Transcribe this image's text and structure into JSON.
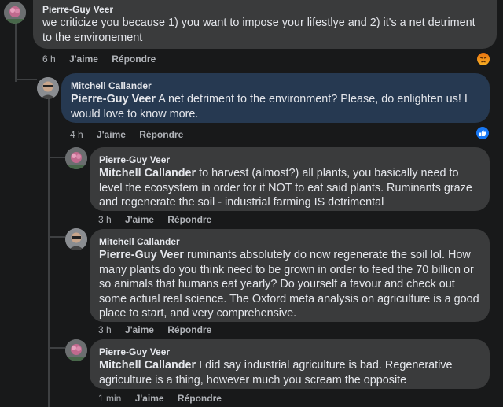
{
  "comments": [
    {
      "author": "Pierre-Guy Veer",
      "mention": "",
      "text": "we criticize you because 1) you want to impose your lifestlye and 2) it's a net detriment to the environement",
      "time": "6 h",
      "like_label": "J'aime",
      "reply_label": "Répondre",
      "reaction": "angry-reaction-icon"
    },
    {
      "author": "Mitchell Callander",
      "mention": "Pierre-Guy Veer",
      "text": "A net detriment to the environment? Please, do enlighten us! I would love to know more.",
      "time": "4 h",
      "like_label": "J'aime",
      "reply_label": "Répondre",
      "reaction": "like-reaction-icon"
    },
    {
      "author": "Pierre-Guy Veer",
      "mention": "Mitchell Callander",
      "text": "to harvest (almost?) all plants, you basically need to level the ecosystem in order for it NOT to eat said plants. Ruminants graze and regenerate the soil - industrial farming IS detrimental",
      "time": "3 h",
      "like_label": "J'aime",
      "reply_label": "Répondre"
    },
    {
      "author": "Mitchell Callander",
      "mention": "Pierre-Guy Veer",
      "text": "ruminants absolutely do now regenerate the soil lol. How many plants do you think need to be grown in order to feed the 70 billion or so animals that humans eat yearly? Do yourself a favour and check out some actual real science. The Oxford meta analysis on agriculture is a good place to start, and very comprehensive.",
      "time": "3 h",
      "like_label": "J'aime",
      "reply_label": "Répondre"
    },
    {
      "author": "Pierre-Guy Veer",
      "mention": "Mitchell Callander",
      "text": "I did say industrial agriculture is bad. Regenerative agriculture is a thing, however much you scream the opposite",
      "time": "1 min",
      "like_label": "J'aime",
      "reply_label": "Répondre"
    }
  ],
  "colors": {
    "background": "#18191a",
    "bubble": "#3a3b3c",
    "highlight_bubble": "#263951",
    "like_blue": "#1877f2",
    "angry_orange": "#e9710f"
  }
}
